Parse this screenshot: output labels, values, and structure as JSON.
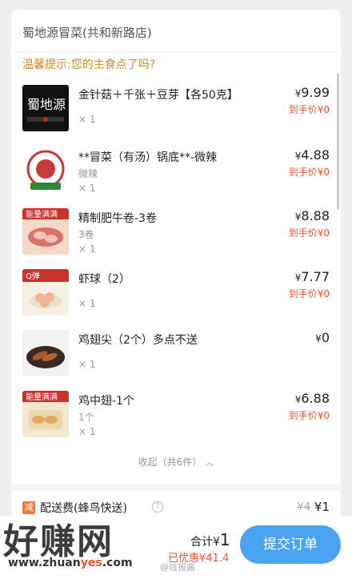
{
  "store": {
    "name": "蜀地源冒菜(共和新路店)"
  },
  "tip": "温馨提示:您的主食点了吗?",
  "final_label": "到手价",
  "items": [
    {
      "name": "金针菇＋千张＋豆芽【各50克】",
      "spec": "",
      "qty": "× 1",
      "price": "9.99",
      "final": "¥0",
      "thumb": "shudiyuan-logo"
    },
    {
      "name": "**冒菜（有汤）锅底**-微辣",
      "spec": "微辣",
      "qty": "× 1",
      "price": "4.88",
      "final": "¥0",
      "thumb": "hotpot-logo"
    },
    {
      "name": "精制肥牛卷-3卷",
      "spec": "3卷",
      "qty": "× 1",
      "price": "8.88",
      "final": "¥0",
      "thumb": "beef-roll"
    },
    {
      "name": "虾球（2）",
      "spec": "",
      "qty": "× 1",
      "price": "7.77",
      "final": "¥0",
      "thumb": "shrimp-ball"
    },
    {
      "name": "鸡翅尖（2个）多点不送",
      "spec": "",
      "qty": "× 1",
      "price": "0",
      "final": "",
      "thumb": "wing-tips"
    },
    {
      "name": "鸡中翅-1个",
      "spec": "1个",
      "qty": "× 1",
      "price": "6.88",
      "final": "¥0",
      "thumb": "chicken-wings"
    }
  ],
  "collapse_label": "收起（共6件）",
  "delivery": {
    "jian": "减",
    "label": "配送费(蜂鸟快送)",
    "old_fee": "¥4",
    "new_fee": "¥1"
  },
  "bottom": {
    "total_prefix": "合计¥",
    "total_value": "1",
    "saved": "已优惠¥41.4",
    "submit": "提交订单"
  },
  "watermark": {
    "title": "好赚网",
    "url_prefix": "www.zhuan",
    "url_accent": "yes",
    "url_suffix": ".com",
    "weibo": "@线报酱"
  },
  "colors": {
    "accent": "#e8542f",
    "tip": "#d0882a",
    "button": "#4aa3f0"
  }
}
